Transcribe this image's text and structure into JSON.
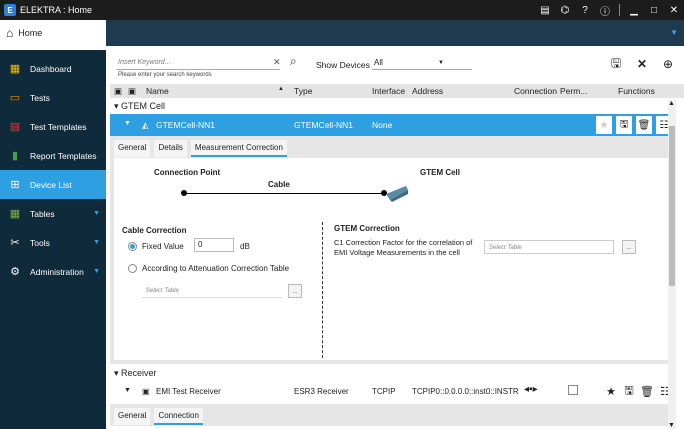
{
  "window": {
    "title": "ELEKTRA : Home"
  },
  "home_tab": {
    "label": "Home"
  },
  "sidebar": {
    "items": [
      {
        "label": "Dashboard",
        "icon": "dashboard-icon"
      },
      {
        "label": "Tests",
        "icon": "tests-icon"
      },
      {
        "label": "Test Templates",
        "icon": "templates-icon"
      },
      {
        "label": "Report Templates",
        "icon": "report-icon"
      },
      {
        "label": "Device List",
        "icon": "device-list-icon",
        "active": true
      },
      {
        "label": "Tables",
        "icon": "tables-icon"
      },
      {
        "label": "Tools",
        "icon": "tools-icon"
      },
      {
        "label": "Administration",
        "icon": "admin-icon"
      }
    ]
  },
  "search": {
    "placeholder": "Insert Keyword...",
    "hint": "Please enter your search keywords",
    "show_devices_label": "Show Devices",
    "show_devices_value": "All"
  },
  "table": {
    "headers": {
      "name": "Name",
      "type": "Type",
      "interface": "Interface",
      "address": "Address",
      "connection": "Connection",
      "perm": "Perm...",
      "functions": "Functions"
    }
  },
  "groups": {
    "gtem": "GTEM Cell",
    "receiver": "Receiver"
  },
  "gtem_device": {
    "name": "GTEMCell-NN1",
    "type": "GTEMCell-NN1",
    "interface": "None"
  },
  "detail_tabs": [
    "General",
    "Details",
    "Measurement Correction"
  ],
  "diagram": {
    "connection_point": "Connection Point",
    "cable": "Cable",
    "gtem_cell": "GTEM Cell"
  },
  "cable_correction": {
    "title": "Cable Correction",
    "fixed_value_label": "Fixed Value",
    "fixed_value": "0",
    "unit": "dB",
    "attenuation_label": "According to Attenuation Correction Table",
    "select_placeholder": "Select Table",
    "browse": ".."
  },
  "gtem_correction": {
    "title": "GTEM Correction",
    "text": "C1 Correction Factor for the correlation of EMI Voltage Measurements in the cell",
    "select_placeholder": "Select Table",
    "browse": ".."
  },
  "receiver_device": {
    "name": "EMI Test Receiver",
    "type": "ESR3 Receiver",
    "interface": "TCPIP",
    "address": "TCPIP0::0.0.0.0::inst0::INSTR"
  },
  "receiver_tabs": [
    "General",
    "Connection"
  ],
  "colors": {
    "accent": "#2e9fe0",
    "sidebar": "#0f2a3a",
    "titlebar": "#1c1c1c"
  }
}
